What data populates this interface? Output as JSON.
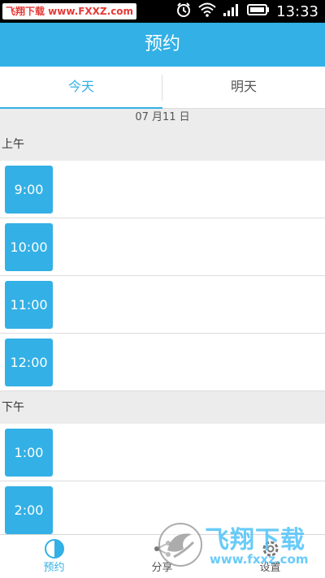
{
  "status_bar": {
    "watermark_text": "飞翔下载 www.FXXZ.com",
    "time": "13:33",
    "icons": [
      "alarm-icon",
      "wifi-icon",
      "signal-icon",
      "battery-icon"
    ]
  },
  "header": {
    "title": "预约"
  },
  "tabs": {
    "today": "今天",
    "tomorrow": "明天",
    "active": "today"
  },
  "content": {
    "date": "07 月11 日",
    "morning": {
      "label": "上午",
      "slots": [
        "9:00",
        "10:00",
        "11:00",
        "12:00"
      ]
    },
    "afternoon": {
      "label": "下午",
      "slots": [
        "1:00",
        "2:00"
      ]
    }
  },
  "bottom_nav": {
    "items": [
      {
        "label": "预约",
        "icon": "pie-chart-icon",
        "active": true
      },
      {
        "label": "分享",
        "icon": "share-icon",
        "active": false
      },
      {
        "label": "设置",
        "icon": "settings-icon",
        "active": false
      }
    ]
  },
  "logo_watermark": {
    "text": "飞翔下载",
    "url": "www.fxxz.com"
  },
  "colors": {
    "accent": "#33b0e5",
    "background_gray": "#ececec",
    "status_bar": "#000000"
  }
}
